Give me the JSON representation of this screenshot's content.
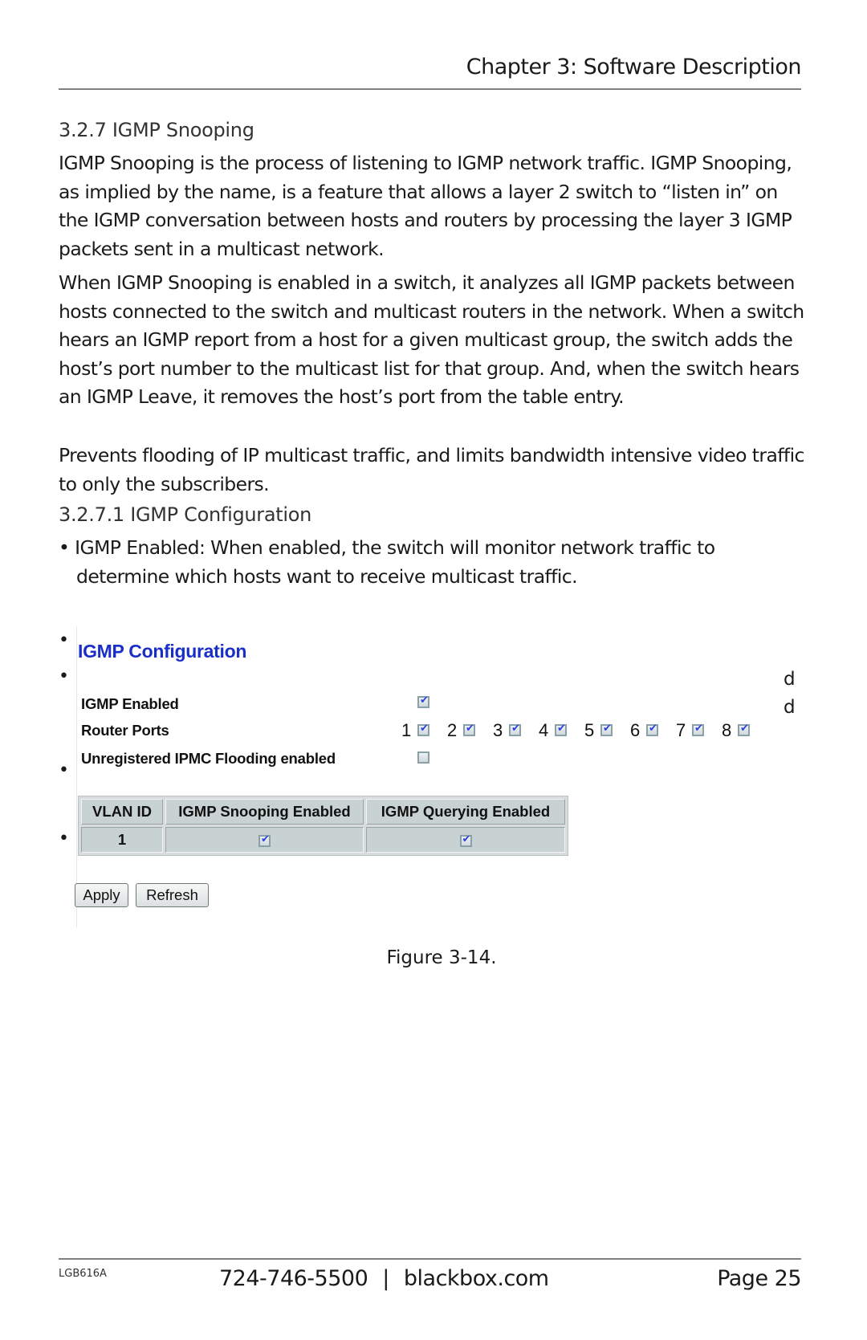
{
  "header": {
    "chapter_title": "Chapter 3: Software Description"
  },
  "section": {
    "heading": "3.2.7 IGMP Snooping",
    "paragraphs": [
      "IGMP Snooping is the process of listening to IGMP network traffic. IGMP Snooping, as implied by the name, is a feature that allows a layer 2 switch to “listen in” on the IGMP conversation between hosts and routers by processing the layer 3 IGMP packets sent in a multicast network.",
      "When IGMP Snooping is enabled in a switch, it analyzes all IGMP packets between hosts connected to the switch and multicast routers in the network. When a switch hears an IGMP report from a host for a given multicast group, the switch adds the host’s port number to the multicast list for that group. And, when the switch hears an IGMP Leave, it removes the host’s port from the table entry.",
      "Prevents flooding of IP multicast traffic, and limits bandwidth intensive video traffic to only the subscribers."
    ]
  },
  "subsection": {
    "heading": "3.2.7.1 IGMP Configuration",
    "bullet_line1": "• IGMP Enabled: When enabled, the switch will monitor network traffic to",
    "bullet_line2": "determine which hosts want to receive multicast traffic.",
    "bullet_glyph": "•",
    "stray_letter": "d"
  },
  "figure": {
    "title": "IGMP Configuration",
    "igmp_enabled_label": "IGMP Enabled",
    "igmp_enabled": true,
    "router_ports_label": "Router Ports",
    "router_ports": [
      {
        "port": "1",
        "checked": true
      },
      {
        "port": "2",
        "checked": true
      },
      {
        "port": "3",
        "checked": true
      },
      {
        "port": "4",
        "checked": true
      },
      {
        "port": "5",
        "checked": true
      },
      {
        "port": "6",
        "checked": true
      },
      {
        "port": "7",
        "checked": true
      },
      {
        "port": "8",
        "checked": true
      }
    ],
    "flooding_label": "Unregistered IPMC Flooding enabled",
    "flooding_enabled": false,
    "table": {
      "headers": [
        "VLAN ID",
        "IGMP Snooping Enabled",
        "IGMP Querying Enabled"
      ],
      "rows": [
        {
          "vlan_id": "1",
          "snooping": true,
          "querying": true
        }
      ]
    },
    "apply_label": "Apply",
    "refresh_label": "Refresh",
    "colors": {
      "title": "#1a2ec8",
      "table_bg": "#c9d2d2",
      "check": "#2a3fe0"
    }
  },
  "caption": "Figure 3-14.",
  "footer": {
    "model": "LGB616A",
    "phone": "724-746-5500",
    "separator": "|",
    "website": "blackbox.com",
    "page": "Page 25"
  }
}
